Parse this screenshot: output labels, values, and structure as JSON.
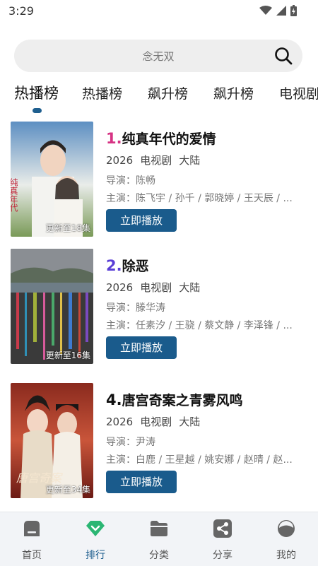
{
  "status_bar": {
    "time": "3:29"
  },
  "search": {
    "placeholder": "念无双"
  },
  "tabs": [
    "热播榜",
    "热播榜",
    "飙升榜",
    "飙升榜",
    "电视剧"
  ],
  "items": [
    {
      "rank": "1.",
      "rank_color": "#d63384",
      "title": "纯真年代的爱情",
      "year": "2026",
      "type": "电视剧",
      "region": "大陆",
      "director": "导演：陈畅",
      "cast": "主演：陈飞宇 / 孙千 / 郭晓婷 / 王天辰 / ...",
      "episodes": "更新至18集",
      "play_label": "立即播放"
    },
    {
      "rank": "2.",
      "rank_color": "#5a3fd6",
      "title": "除恶",
      "year": "2026",
      "type": "电视剧",
      "region": "大陆",
      "director": "导演：滕华涛",
      "cast": "主演：任素汐 / 王骁 / 蔡文静 / 李泽锋 / ...",
      "episodes": "更新至16集",
      "play_label": "立即播放"
    },
    {
      "rank": "4.",
      "rank_color": "#111111",
      "title": "唐宫奇案之青雾风鸣",
      "year": "2026",
      "type": "电视剧",
      "region": "大陆",
      "director": "导演：尹涛",
      "cast": "主演：白鹿 / 王星越 / 姚安娜 / 赵晴 / 赵...",
      "episodes": "更新至34集",
      "play_label": "立即播放"
    }
  ],
  "bottom_nav": [
    {
      "label": "首页",
      "icon": "home-icon"
    },
    {
      "label": "排行",
      "icon": "ranking-icon"
    },
    {
      "label": "分类",
      "icon": "folder-icon"
    },
    {
      "label": "分享",
      "icon": "share-icon"
    },
    {
      "label": "我的",
      "icon": "profile-icon"
    }
  ],
  "colors": {
    "accent": "#1a5b8c",
    "active_nav": "#2bb673"
  }
}
